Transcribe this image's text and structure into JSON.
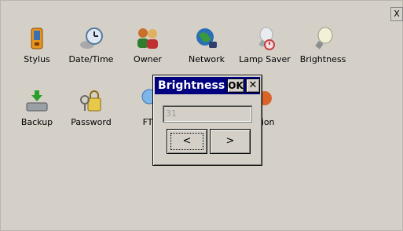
{
  "window": {
    "close_label": "X"
  },
  "icons": [
    {
      "label": "Stylus",
      "icon": "stylus-icon"
    },
    {
      "label": "Date/Time",
      "icon": "clock-icon"
    },
    {
      "label": "Owner",
      "icon": "owner-icon"
    },
    {
      "label": "Network",
      "icon": "network-globe-icon"
    },
    {
      "label": "Lamp Saver",
      "icon": "lamp-saver-icon"
    },
    {
      "label": "Brightness",
      "icon": "brightness-bulb-icon"
    },
    {
      "label": "Backup",
      "icon": "backup-drive-icon"
    },
    {
      "label": "Password",
      "icon": "password-keys-icon"
    },
    {
      "label": "FT",
      "icon": "ftp-icon"
    },
    {
      "label": "mation",
      "icon": "information-icon"
    }
  ],
  "dialog": {
    "title": "Brightness",
    "ok_label": "OK",
    "close_label": "✕",
    "value": "31",
    "prev_label": "<",
    "next_label": ">"
  }
}
